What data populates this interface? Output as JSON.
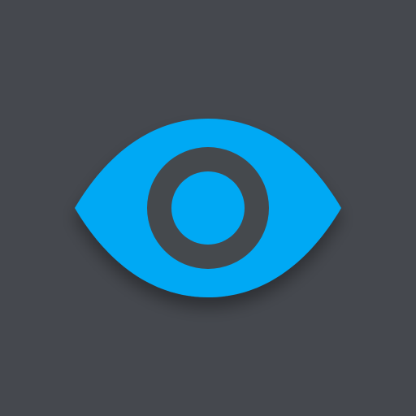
{
  "icon": {
    "name": "eye-icon",
    "background_color": "#45484e",
    "eye_color": "#03a9f4",
    "pupil_ring_color": "#45484e",
    "shadow_color": "#000000"
  }
}
